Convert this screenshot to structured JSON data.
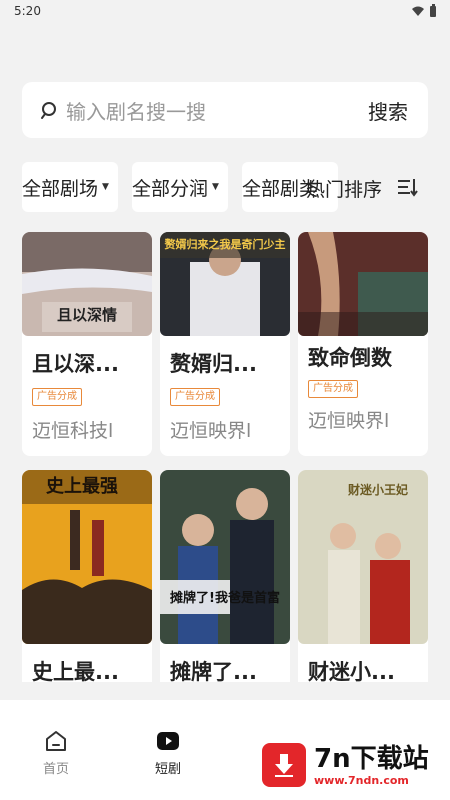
{
  "status_bar": {
    "time": "5:20"
  },
  "search": {
    "placeholder": "输入剧名搜一搜",
    "button_label": "搜索"
  },
  "filters": [
    {
      "label": "全部剧场"
    },
    {
      "label": "全部分润"
    },
    {
      "label": "全部剧类"
    }
  ],
  "sort": {
    "label": "热门排序"
  },
  "dramas": [
    {
      "title": "且以深...",
      "tag": "广告分成",
      "company": "迈恒科技l",
      "poster_text": "且以深情"
    },
    {
      "title": "赘婿归...",
      "tag": "广告分成",
      "company": "迈恒映界l",
      "poster_text": "赘婿归来之我是奇门少主"
    },
    {
      "title": "致命倒数",
      "tag": "广告分成",
      "company": "迈恒映界l",
      "poster_text": ""
    },
    {
      "title": "史上最...",
      "tag": "",
      "company": "",
      "poster_text": "史上最强"
    },
    {
      "title": "摊牌了...",
      "tag": "",
      "company": "",
      "poster_text": "摊牌了!我爸是首富"
    },
    {
      "title": "财迷小...",
      "tag": "",
      "company": "",
      "poster_text": "财迷小王妃"
    }
  ],
  "bottom_nav": [
    {
      "label": "首页",
      "icon": "home-icon"
    },
    {
      "label": "短剧",
      "icon": "play-icon"
    }
  ],
  "watermark": {
    "title": "7n下载站",
    "url": "www.7ndn.com"
  },
  "colors": {
    "accent_orange": "#e8893a",
    "watermark_red": "#e3262a",
    "background": "#f2f2f2"
  }
}
